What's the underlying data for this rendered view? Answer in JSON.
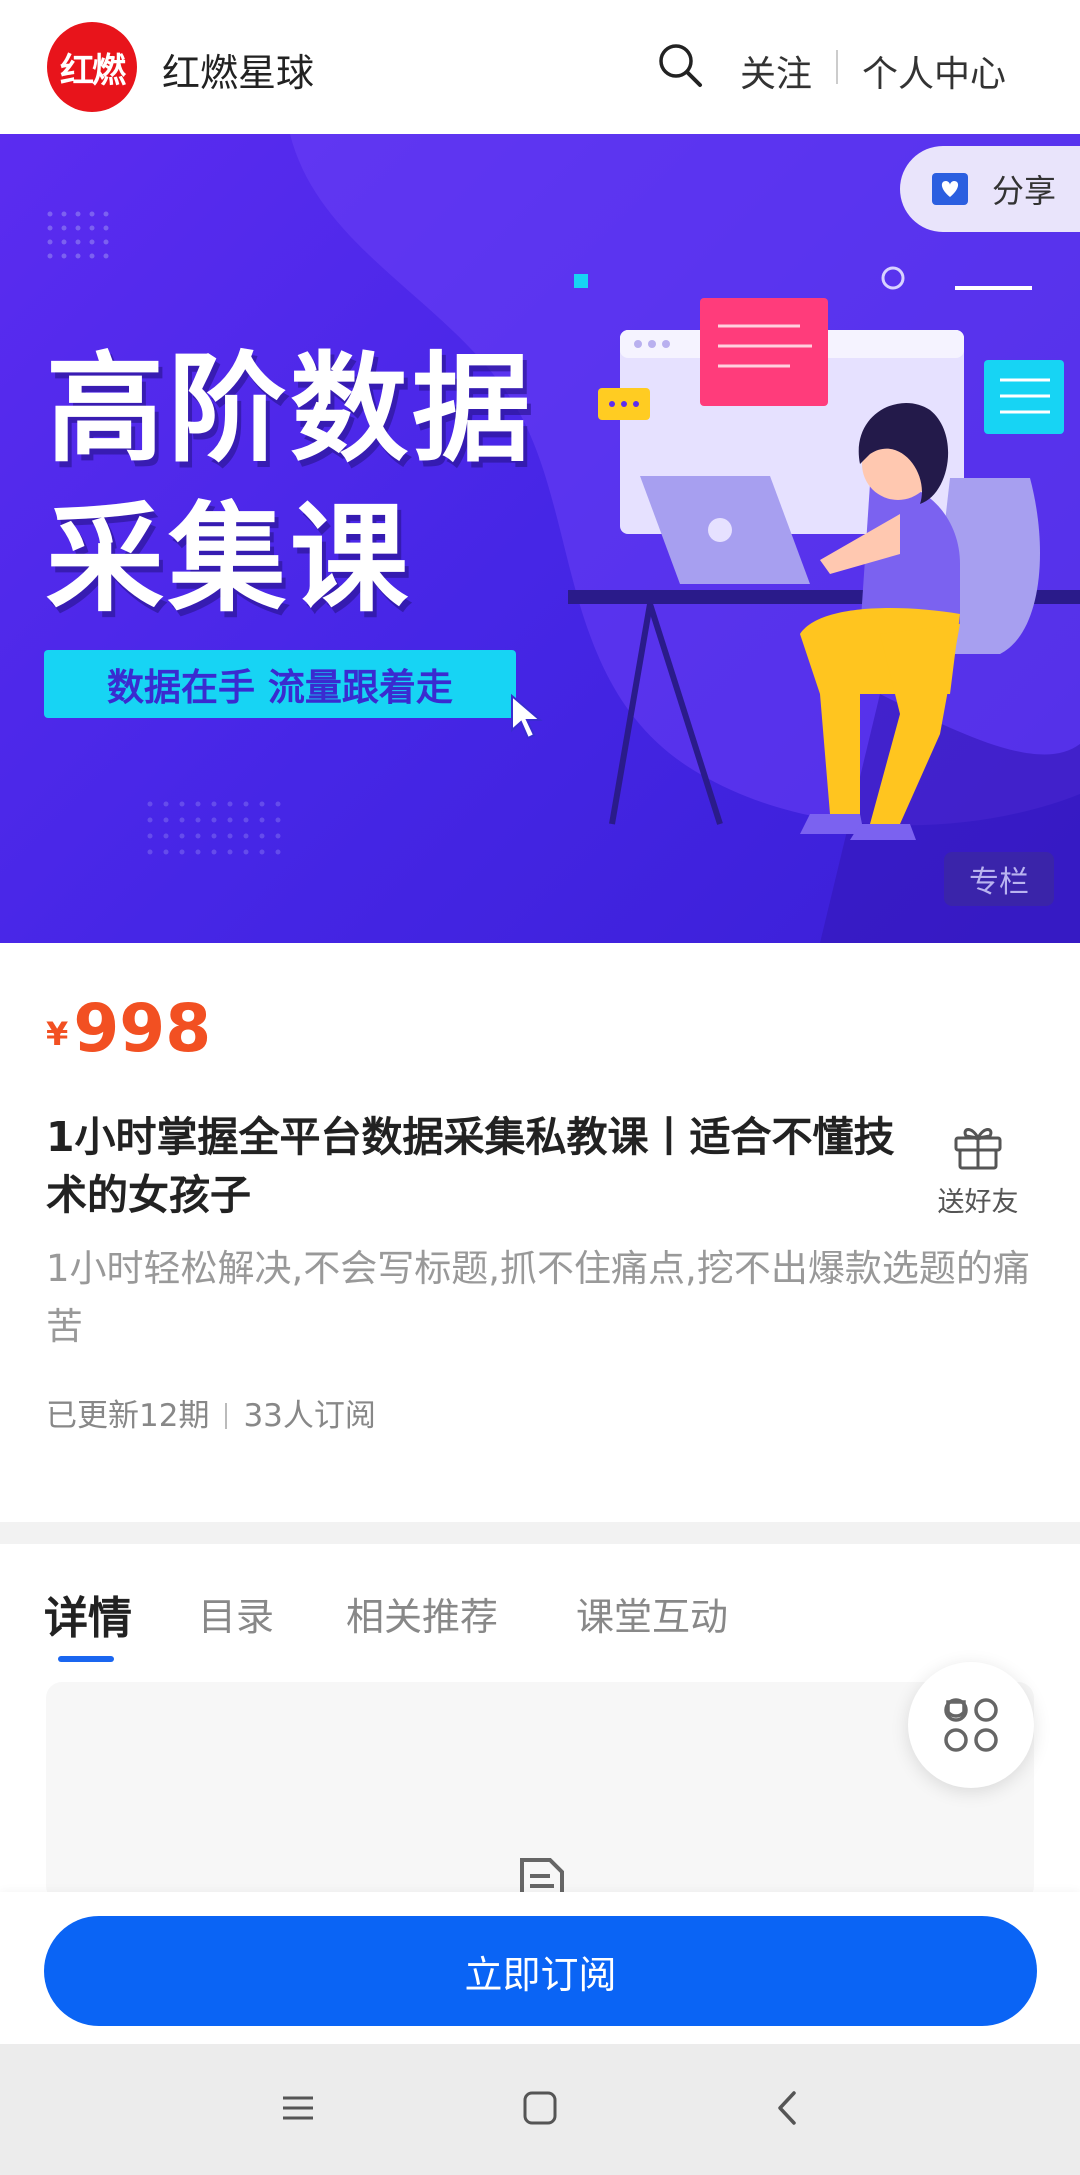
{
  "header": {
    "logo_text": "红燃",
    "brand_name": "红燃星球",
    "follow_label": "关注",
    "personal_center_label": "个人中心"
  },
  "banner": {
    "title_line1": "高阶数据",
    "title_line2": "采集课",
    "slogan": "数据在手 流量跟着走",
    "share_label": "分享",
    "column_badge": "专栏"
  },
  "course": {
    "price_symbol": "¥",
    "price": "998",
    "title": "1小时掌握全平台数据采集私教课丨适合不懂技术的女孩子",
    "gift_label": "送好友",
    "description": "1小时轻松解决,不会写标题,抓不住痛点,挖不出爆款选题的痛苦",
    "updated": "已更新12期",
    "subscribers": "33人订阅"
  },
  "tabs": [
    {
      "label": "详情",
      "active": true
    },
    {
      "label": "目录",
      "active": false
    },
    {
      "label": "相关推荐",
      "active": false
    },
    {
      "label": "课堂互动",
      "active": false
    }
  ],
  "bottom": {
    "subscribe_label": "立即订阅"
  },
  "colors": {
    "brand_red": "#e8141b",
    "price_orange": "#f25022",
    "primary_blue": "#0a64f5",
    "banner_purple": "#4626e6",
    "slogan_cyan": "#17d4f4"
  },
  "icons": {
    "search": "search-icon",
    "share": "share-heart-icon",
    "gift": "gift-icon",
    "fab": "grid-menu-icon",
    "doc": "document-icon",
    "nav_menu": "menu-icon",
    "nav_home": "home-icon",
    "nav_back": "back-icon"
  }
}
